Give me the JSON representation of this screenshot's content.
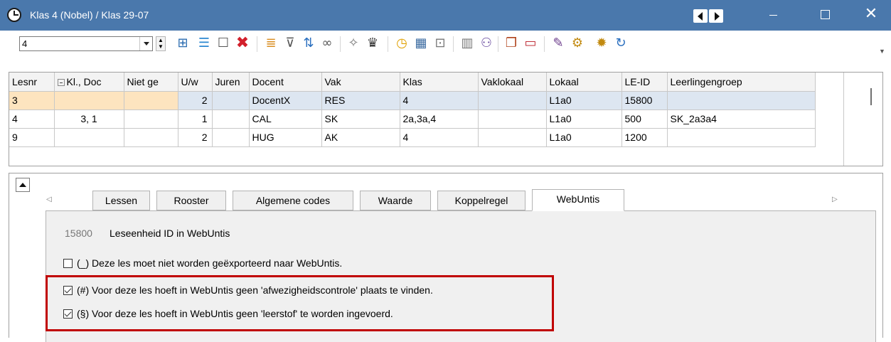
{
  "window": {
    "title": "Klas 4 (Nobel) / Klas  29-07",
    "accent_color": "#4a78ac",
    "controls": [
      "nav-prev-icon",
      "nav-next-icon",
      "minimize-icon",
      "maximize-icon",
      "close-icon"
    ],
    "close_glyph": "✕"
  },
  "toolbar": {
    "selector_value": "4",
    "icons": [
      "expand-icon",
      "list-icon",
      "new-icon",
      "delete-icon",
      "copy-icon",
      "filter-icon",
      "sort-icon",
      "link-icon",
      "magic-icon",
      "graduation-icon",
      "clock-icon",
      "calendar-icon",
      "grid-icon",
      "columns-icon",
      "users-icon",
      "windows-icon",
      "monitor-icon",
      "edit-icon",
      "settings-doc-icon",
      "gear-icon",
      "refresh-icon"
    ]
  },
  "grid": {
    "columns": [
      "Lesnr",
      "Kl., Doc",
      "Niet ge",
      "U/w",
      "Juren",
      "Docent",
      "Vak",
      "Klas",
      "Vaklokaal",
      "Lokaal",
      "LE-ID",
      "Leerlingengroep"
    ],
    "rows": [
      {
        "lesnr": "3",
        "kldoc": "",
        "nietge": "",
        "uw": "2",
        "juren": "",
        "docent": "DocentX",
        "vak": "RES",
        "klas": "4",
        "vaklokaal": "",
        "lokaal": "L1a0",
        "leid": "15800",
        "groep": ""
      },
      {
        "lesnr": "4",
        "kldoc": "3, 1",
        "nietge": "",
        "uw": "1",
        "juren": "",
        "docent": "CAL",
        "vak": "SK",
        "klas": "2a,3a,4",
        "vaklokaal": "",
        "lokaal": "L1a0",
        "leid": "500",
        "groep": "SK_2a3a4"
      },
      {
        "lesnr": "9",
        "kldoc": "",
        "nietge": "",
        "uw": "2",
        "juren": "",
        "docent": "HUG",
        "vak": "AK",
        "klas": "4",
        "vaklokaal": "",
        "lokaal": "L1a0",
        "leid": "1200",
        "groep": ""
      }
    ]
  },
  "tabs": [
    {
      "label": "Lessen"
    },
    {
      "label": "Rooster"
    },
    {
      "label": "Algemene codes"
    },
    {
      "label": "Waarde"
    },
    {
      "label": "Koppelregel"
    },
    {
      "label": "WebUntis"
    }
  ],
  "webuntis": {
    "le_id_value": "15800",
    "le_id_label": "Leseenheid ID in WebUntis",
    "options": [
      {
        "label": "(_) Deze les moet niet worden geëxporteerd naar WebUntis.",
        "checked": false
      },
      {
        "label": "(#) Voor deze les hoeft in WebUntis geen 'afwezigheidscontrole' plaats te vinden.",
        "checked": true
      },
      {
        "label": "(§) Voor deze les hoeft in WebUntis geen 'leerstof' te worden ingevoerd.",
        "checked": true
      }
    ],
    "highlight_color": "#c00000"
  }
}
